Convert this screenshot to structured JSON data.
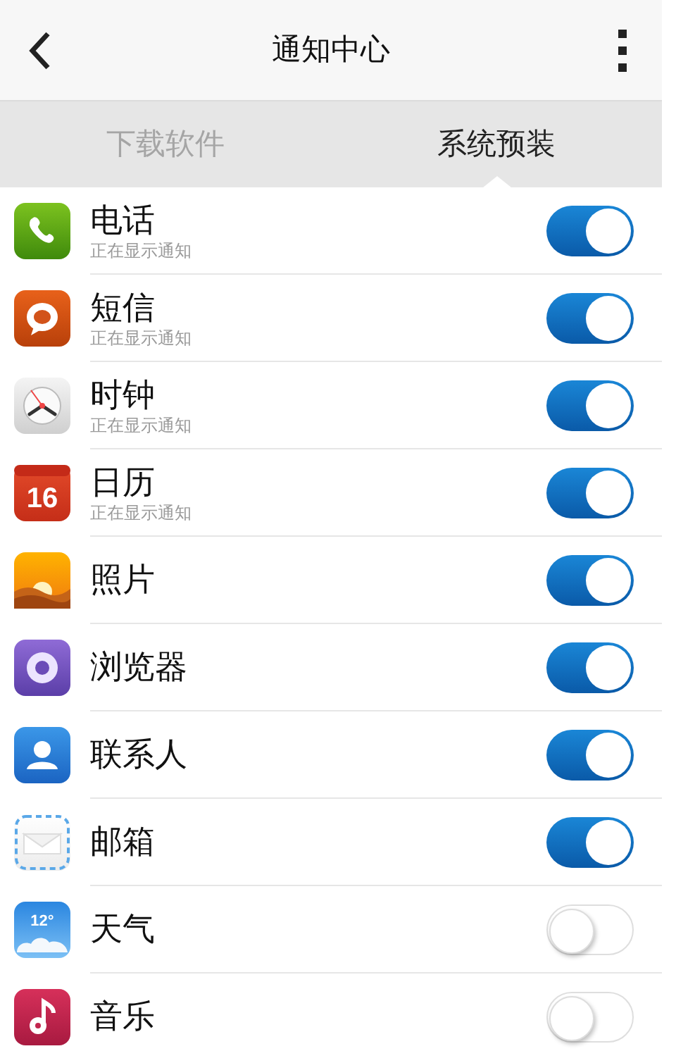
{
  "header": {
    "title": "通知中心"
  },
  "tabs": [
    {
      "label": "下载软件",
      "selected": false
    },
    {
      "label": "系统预装",
      "selected": true
    }
  ],
  "apps": [
    {
      "name": "电话",
      "status": "正在显示通知",
      "on": true
    },
    {
      "name": "短信",
      "status": "正在显示通知",
      "on": true
    },
    {
      "name": "时钟",
      "status": "正在显示通知",
      "on": true
    },
    {
      "name": "日历",
      "status": "正在显示通知",
      "on": true,
      "icon_text": "16"
    },
    {
      "name": "照片",
      "on": true
    },
    {
      "name": "浏览器",
      "on": true
    },
    {
      "name": "联系人",
      "on": true
    },
    {
      "name": "邮箱",
      "on": true
    },
    {
      "name": "天气",
      "on": false,
      "icon_text": "12°"
    },
    {
      "name": "音乐",
      "on": false
    }
  ]
}
